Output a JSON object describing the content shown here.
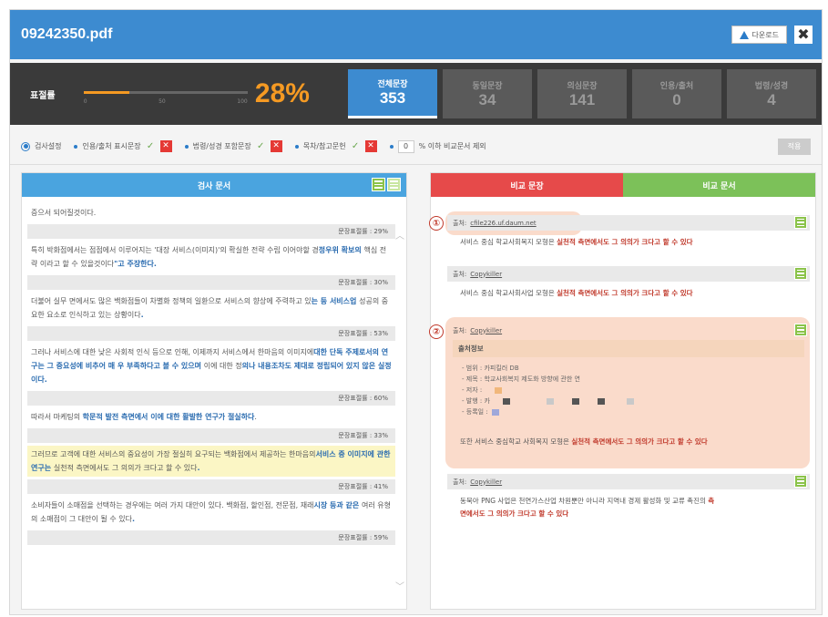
{
  "window": {
    "title": "09242350.pdf",
    "download_label": "다운로드",
    "close_label": "✖"
  },
  "stats": {
    "label": "표절률",
    "progress_fraction": 0.28,
    "percent_text": "28%",
    "ticks": [
      "0",
      "50",
      "100"
    ],
    "tabs": [
      {
        "label": "전체문장",
        "value": "353",
        "active": true
      },
      {
        "label": "동일문장",
        "value": "34",
        "active": false
      },
      {
        "label": "의심문장",
        "value": "141",
        "active": false
      },
      {
        "label": "인용/출처",
        "value": "0",
        "active": false
      },
      {
        "label": "법령/성경",
        "value": "4",
        "active": false
      }
    ]
  },
  "settings": {
    "main_label": "검사설정",
    "options": [
      {
        "label": "인용/출처 표시문장"
      },
      {
        "label": "법령/성경 포함문장"
      },
      {
        "label": "목차/참고문헌"
      }
    ],
    "threshold_value": "0",
    "threshold_label": "% 이하 비교문서 제외",
    "apply_label": "적용"
  },
  "left_panel": {
    "header": "검사 문서",
    "items": [
      {
        "type": "text",
        "text": "증으서 되어질것이다."
      },
      {
        "type": "rate",
        "text": "문장표절률 : 29%"
      },
      {
        "type": "text",
        "parts": [
          "특히 박화점에서는 점점에서 이루어지는 '대장 서비스(이미지)'의 확실한 전략 수립 이어야할 경",
          "정우위 확보의 ",
          "핵심 전략 이라고 할 수 있을것이다",
          "\"고 주장한다."
        ]
      },
      {
        "type": "rate",
        "text": "문장표절률 : 30%"
      },
      {
        "type": "text",
        "parts": [
          "더불어 실무 면에서도 많은 백화점들이 차별화 정책의 일환으로 서비스의 향상에 주력하고 있",
          "는 등 서비스업 ",
          "성공의 중요한 요소로 인식하고 있는 상황이다",
          "."
        ]
      },
      {
        "type": "rate",
        "text": "문장표절률 : 53%"
      },
      {
        "type": "text",
        "parts": [
          "그러나 서비스에 대한 낮은 사회적 인식 등으로 인해, 이제까지 서비스에서 한마음의 이미지에",
          "대한 단독 주제로서의 연구는 그 중요성에 비추어 매 우 부족하다고 볼 수 있으며 ",
          "이에 대한 정",
          "의나 내용조차도 제대로 정립되어 있지 않은 실정이다."
        ]
      },
      {
        "type": "rate",
        "text": "문장표절률 : 60%"
      },
      {
        "type": "text",
        "parts": [
          "따라서 마케팅의 ",
          "학문적 발전 측면에서 이에 대한 활발한 연구가 절실하다",
          "."
        ]
      },
      {
        "type": "rate",
        "text": "문장표절률 : 33%"
      },
      {
        "type": "text",
        "yellow": true,
        "parts": [
          "그러므로 고객에 대한 서비스의 중요성이 가장 절실히 요구되는 백화점에서 제공하는 한마음의",
          "서비스 중 이미지에 관한 연구는 ",
          "실천적 측면에서도 그 의의가 크다고 할 수 있다",
          "."
        ]
      },
      {
        "type": "rate",
        "text": "문장표절률 : 41%"
      },
      {
        "type": "text",
        "parts": [
          "소비자들이 소매점을 선택하는 경우에는 여러 가지 대안이 있다. 백화점, 할인점, 전문점, 재래",
          "시장 등과 같은 ",
          "여러 유형의 소매점이 그 대안이 될 수 있다",
          "."
        ]
      },
      {
        "type": "rate",
        "text": "문장표절률 : 59%"
      }
    ]
  },
  "right_panel": {
    "tab_compare_sentence": "비교 문장",
    "tab_compare_doc": "비교 문서",
    "annotation_1": "①",
    "annotation_2": "②",
    "sources": [
      {
        "prefix": "출처:",
        "name": "cfile226.uf.daum.net",
        "text_plain": "서비스 중심 학교사회복지 모형은 ",
        "text_hl": "실천적 측면에서도 그 의의가 크다고 할 수 있다"
      },
      {
        "prefix": "출처:",
        "name": "Copykiller",
        "text_plain": "서비스 중심 학교사회사업 모형은 ",
        "text_hl": "실천적 측면에서도 그 의의가 크다고 할 수 있다"
      },
      {
        "prefix": "출처:",
        "name": "Copykiller",
        "info_title": "출처정보",
        "info_lines": [
          "- 범위 : 카피킬러 DB",
          "- 제목 : 학교사회복지 제도화 방향에 관한 연",
          "- 저자 :",
          "- 발행 : 카",
          "- 등록일 :"
        ],
        "text_plain": "또한 서비스 중심학교 사회복지 모형은 ",
        "text_hl": "실천적 측면에서도 그 의의가 크다고 할 수 있다"
      },
      {
        "prefix": "출처:",
        "name": "Copykiller",
        "text_plain": "동북아 PNG 사업은 천연가스산업 차원뿐만 아니라 지역내 경제 활성화 및 교류 촉진의 ",
        "text_hl_a": "측",
        "text_hl_b": "면에서도 그 의의가 크다고 할 수 있다"
      }
    ]
  },
  "colors": {
    "title_blue": "#3d8bd0",
    "orange": "#f59a23",
    "red": "#e64a4a",
    "green": "#7cc159",
    "dark": "#3a3a3a"
  },
  "icons": [
    "upload-icon",
    "close-icon",
    "radio-icon",
    "check-icon",
    "x-icon",
    "list-icon",
    "chevron-up-icon",
    "chevron-down-icon"
  ]
}
